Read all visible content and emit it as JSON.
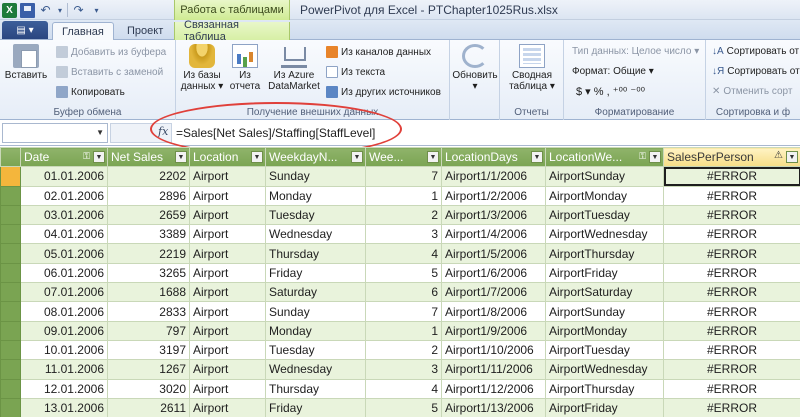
{
  "window": {
    "title": "PowerPivot для Excel - PTChapter1025Rus.xlsx",
    "context_tab_title": "Работа с таблицами"
  },
  "tabs": {
    "file_label": "▤ ▾",
    "home": "Главная",
    "design": "Проект",
    "linked_table": "Связанная таблица"
  },
  "ribbon": {
    "clipboard": {
      "paste": "Вставить",
      "append": "Добавить из буфера",
      "replace": "Вставить с заменой",
      "copy": "Копировать",
      "group": "Буфер обмена"
    },
    "external": {
      "from_db": "Из базы данных ▾",
      "from_report": "Из отчета",
      "from_azure": "Из Azure DataMarket",
      "from_feeds": "Из каналов данных",
      "from_text": "Из текста",
      "from_other": "Из других источников",
      "group": "Получение внешних данных"
    },
    "refresh": {
      "label": "Обновить",
      "arrow": "▾"
    },
    "reports": {
      "pivot": "Сводная таблица ▾",
      "group": "Отчеты"
    },
    "formatting": {
      "datatype": "Тип данных: Целое число ▾",
      "format": "Формат: Общие ▾",
      "symbols": "$ ▾  %  ,  ⁺⁰⁰  ⁻⁰⁰",
      "group": "Форматирование"
    },
    "sort": {
      "asc": "Сортировать от",
      "desc": "Сортировать от",
      "clear": "Отменить сорт",
      "group": "Сортировка и ф"
    }
  },
  "formula_bar": {
    "fx": "fx",
    "formula": "=Sales[Net Sales]/Staffing[StaffLevel]"
  },
  "columns": [
    "Date",
    "Net Sales",
    "Location",
    "WeekdayN...",
    "Wee...",
    "LocationDays",
    "LocationWe...",
    "SalesPerPerson"
  ],
  "rows": [
    [
      "01.01.2006",
      "2202",
      "Airport",
      "Sunday",
      "7",
      "Airport1/1/2006",
      "AirportSunday",
      "#ERROR"
    ],
    [
      "02.01.2006",
      "2896",
      "Airport",
      "Monday",
      "1",
      "Airport1/2/2006",
      "AirportMonday",
      "#ERROR"
    ],
    [
      "03.01.2006",
      "2659",
      "Airport",
      "Tuesday",
      "2",
      "Airport1/3/2006",
      "AirportTuesday",
      "#ERROR"
    ],
    [
      "04.01.2006",
      "3389",
      "Airport",
      "Wednesday",
      "3",
      "Airport1/4/2006",
      "AirportWednesday",
      "#ERROR"
    ],
    [
      "05.01.2006",
      "2219",
      "Airport",
      "Thursday",
      "4",
      "Airport1/5/2006",
      "AirportThursday",
      "#ERROR"
    ],
    [
      "06.01.2006",
      "3265",
      "Airport",
      "Friday",
      "5",
      "Airport1/6/2006",
      "AirportFriday",
      "#ERROR"
    ],
    [
      "07.01.2006",
      "1688",
      "Airport",
      "Saturday",
      "6",
      "Airport1/7/2006",
      "AirportSaturday",
      "#ERROR"
    ],
    [
      "08.01.2006",
      "2833",
      "Airport",
      "Sunday",
      "7",
      "Airport1/8/2006",
      "AirportSunday",
      "#ERROR"
    ],
    [
      "09.01.2006",
      "797",
      "Airport",
      "Monday",
      "1",
      "Airport1/9/2006",
      "AirportMonday",
      "#ERROR"
    ],
    [
      "10.01.2006",
      "3197",
      "Airport",
      "Tuesday",
      "2",
      "Airport1/10/2006",
      "AirportTuesday",
      "#ERROR"
    ],
    [
      "11.01.2006",
      "1267",
      "Airport",
      "Wednesday",
      "3",
      "Airport1/11/2006",
      "AirportWednesday",
      "#ERROR"
    ],
    [
      "12.01.2006",
      "3020",
      "Airport",
      "Thursday",
      "4",
      "Airport1/12/2006",
      "AirportThursday",
      "#ERROR"
    ],
    [
      "13.01.2006",
      "2611",
      "Airport",
      "Friday",
      "5",
      "Airport1/13/2006",
      "AirportFriday",
      "#ERROR"
    ]
  ],
  "colors": {
    "header_green": "#7aa452",
    "selected_header": "#f6dd86",
    "highlight_ellipse": "#e0403a"
  }
}
